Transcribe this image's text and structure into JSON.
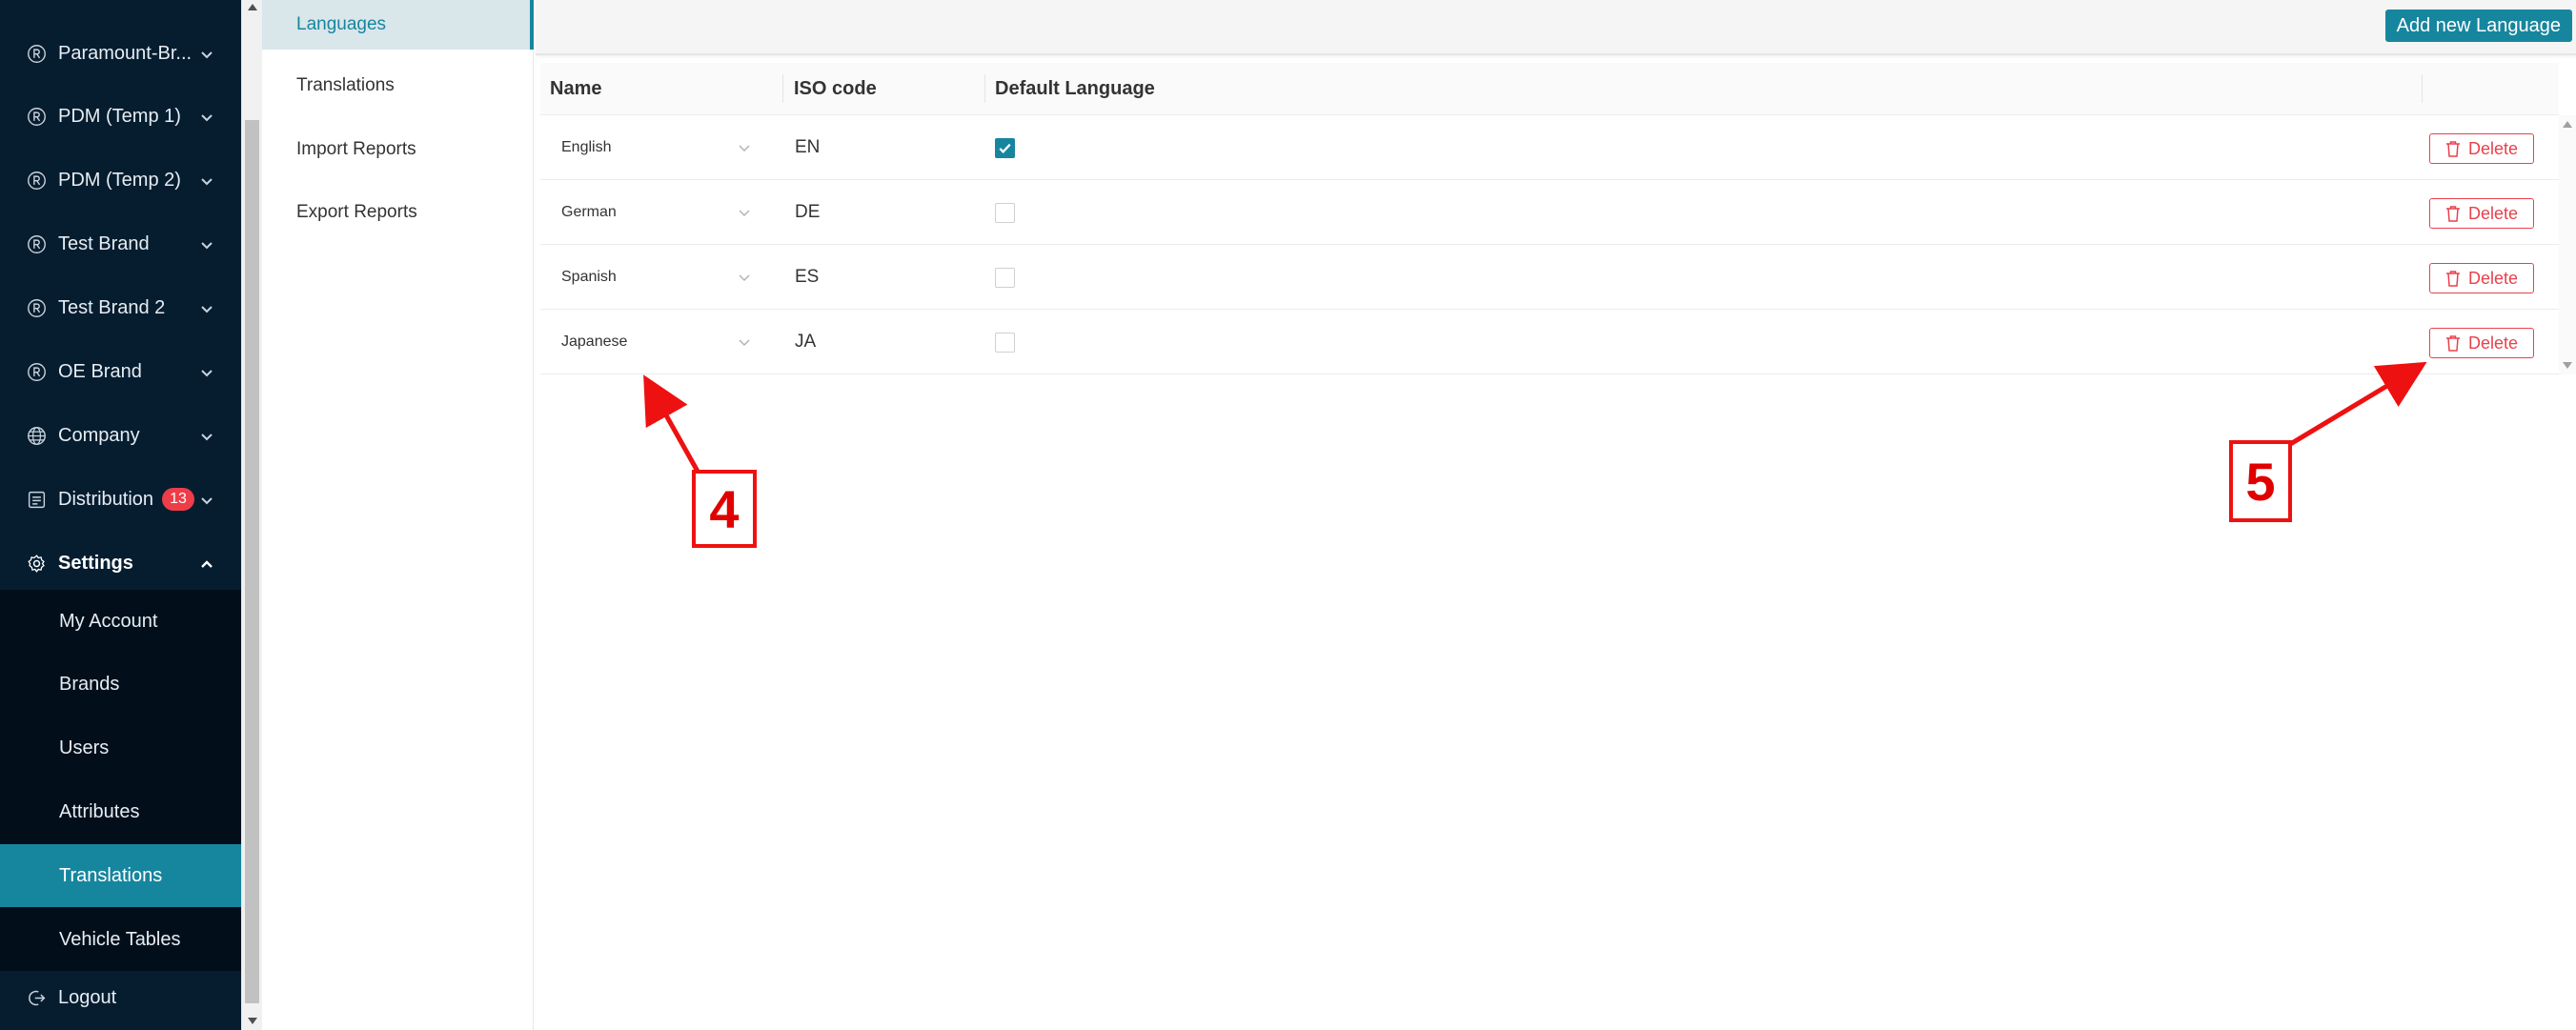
{
  "sidebar": {
    "items": [
      {
        "label": "Paramount-Br...",
        "icon": "registered-icon"
      },
      {
        "label": "PDM (Temp 1)",
        "icon": "registered-icon"
      },
      {
        "label": "PDM (Temp 2)",
        "icon": "registered-icon"
      },
      {
        "label": "Test Brand",
        "icon": "registered-icon"
      },
      {
        "label": "Test Brand 2",
        "icon": "registered-icon"
      },
      {
        "label": "OE Brand",
        "icon": "registered-icon"
      },
      {
        "label": "Company",
        "icon": "globe-icon"
      },
      {
        "label": "Distribution",
        "icon": "distribution-icon",
        "badge": "13"
      },
      {
        "label": "Settings",
        "icon": "gear-icon",
        "expanded": true
      }
    ],
    "settings_submenu": [
      {
        "label": "My Account"
      },
      {
        "label": "Brands"
      },
      {
        "label": "Users"
      },
      {
        "label": "Attributes"
      },
      {
        "label": "Translations",
        "active": true
      },
      {
        "label": "Vehicle Tables"
      }
    ],
    "logout": {
      "label": "Logout",
      "icon": "logout-icon"
    }
  },
  "settings_menu": {
    "items": [
      {
        "label": "Languages",
        "active": true
      },
      {
        "label": "Translations"
      },
      {
        "label": "Import Reports"
      },
      {
        "label": "Export Reports"
      }
    ]
  },
  "toolbar": {
    "add_label": "Add new Language"
  },
  "table": {
    "headers": {
      "name": "Name",
      "iso": "ISO code",
      "default": "Default Language"
    },
    "rows": [
      {
        "name": "English",
        "iso": "EN",
        "default": true,
        "action": "Delete"
      },
      {
        "name": "German",
        "iso": "DE",
        "default": false,
        "action": "Delete"
      },
      {
        "name": "Spanish",
        "iso": "ES",
        "default": false,
        "action": "Delete"
      },
      {
        "name": "Japanese",
        "iso": "JA",
        "default": false,
        "action": "Delete"
      }
    ]
  },
  "annotations": {
    "step4": "4",
    "step5": "5"
  },
  "colors": {
    "accent": "#16869e",
    "sidebar_bg": "#061d30",
    "danger": "#e8414c",
    "annotation": "#ee1111"
  }
}
